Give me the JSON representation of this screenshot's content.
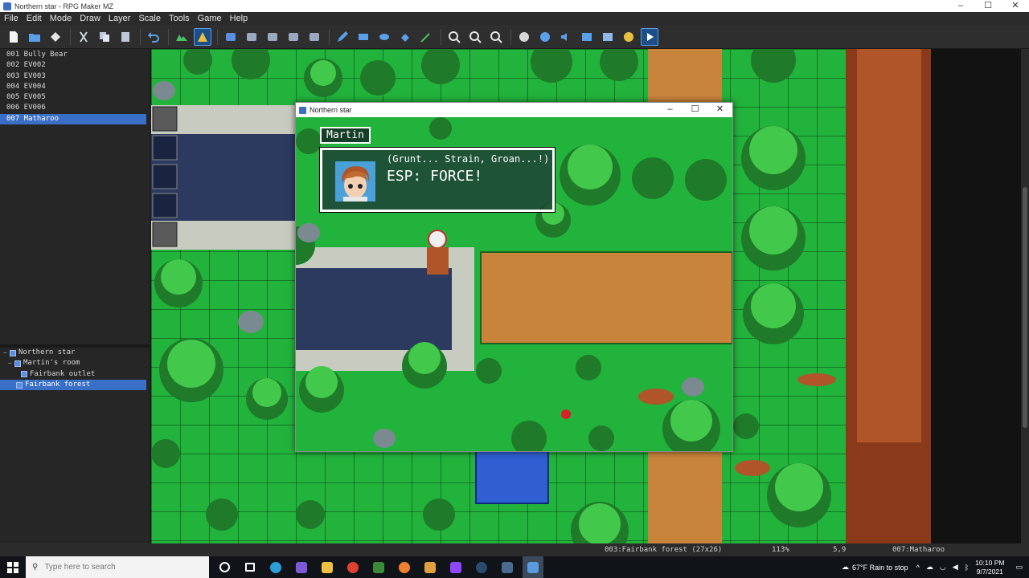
{
  "window": {
    "title": "Northern star - RPG Maker MZ",
    "controls": [
      "–",
      "☐",
      "✕"
    ]
  },
  "menu": [
    "File",
    "Edit",
    "Mode",
    "Draw",
    "Layer",
    "Scale",
    "Tools",
    "Game",
    "Help"
  ],
  "events": [
    "001 Bully Bear",
    "002 EV002",
    "003 EV003",
    "004 EV004",
    "005 EV005",
    "006 EV006",
    "007 Matharoo"
  ],
  "selected_event": "007 Matharoo",
  "maps": {
    "root": "Northern star",
    "child": "Martin's room",
    "items": [
      "Fairbank outlet",
      "Fairbank forest"
    ],
    "selected": "Fairbank forest"
  },
  "game_window": {
    "title": "Northern star",
    "speaker": "Martin",
    "line1": "(Grunt... Strain, Groan...!)",
    "line2": "ESP: FORCE!"
  },
  "status": {
    "map": "003:Fairbank forest (27x26)",
    "zoom": "113%",
    "coords": "5,9",
    "event": "007:Matharoo"
  },
  "taskbar": {
    "search_placeholder": "Type here to search",
    "weather": "67°F  Rain to stop",
    "time": "10:10 PM",
    "date": "9/7/2021"
  },
  "colors": {
    "grass": "#22b33c",
    "path": "#c8843a",
    "water": "#2f5fd0",
    "selection": "#3a6fc8",
    "tree_dark": "#1f7a2a",
    "tree_light": "#42c84a"
  }
}
